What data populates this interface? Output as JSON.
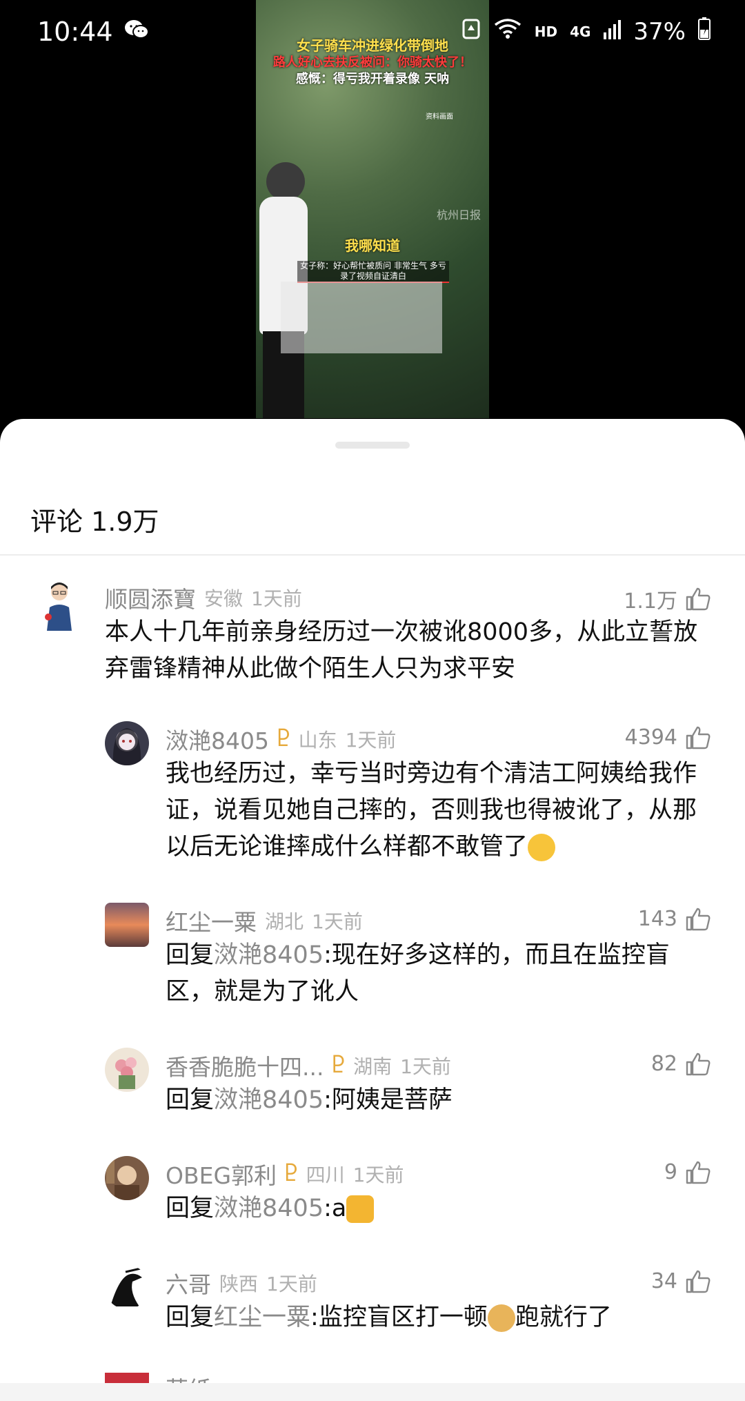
{
  "status": {
    "time": "10:44",
    "right": {
      "hd": "HD",
      "network": "4G",
      "battery": "37%"
    }
  },
  "video": {
    "caption_line1": "女子骑车冲进绿化带倒地",
    "caption_line2": "路人好心去扶反被问：你骑太快了！",
    "caption_line3": "感慨：得亏我开着录像 天呐",
    "credit": "资料画面",
    "watermark": "杭州日报",
    "speech": "我哪知道",
    "claim": "女子称：好心帮忙被质问 非常生气 多亏录了视频自证清白"
  },
  "sheet": {
    "title": "评论 1.9万",
    "comments": [
      {
        "name": "顺圆添寶",
        "region": "安徽",
        "time": "1天前",
        "likes": "1.1万",
        "text": "本人十几年前亲身经历过一次被讹8000多，从此立誓放弃雷锋精神从此做个陌生人只为求平安"
      },
      {
        "name": "滧滟8405",
        "region": "山东",
        "time": "1天前",
        "likes": "4394",
        "text": "我也经历过，幸亏当时旁边有个清洁工阿姨给我作证，说看见她自己摔的，否则我也得被讹了，从那以后无论谁摔成什么样都不敢管了"
      },
      {
        "name": "红尘一粟",
        "region": "湖北",
        "time": "1天前",
        "likes": "143",
        "reply_prefix": "回复",
        "reply_target": "滧滟8405",
        "text": ":现在好多这样的，而且在监控盲区，就是为了讹人"
      },
      {
        "name": "香香脆脆十四...",
        "region": "湖南",
        "time": "1天前",
        "likes": "82",
        "reply_prefix": "回复",
        "reply_target": "滧滟8405",
        "text": ":阿姨是菩萨"
      },
      {
        "name": "OBEG郭利",
        "region": "四川",
        "time": "1天前",
        "likes": "9",
        "reply_prefix": "回复",
        "reply_target": "滧滟8405",
        "text": ":a"
      },
      {
        "name": "六哥",
        "region": "陕西",
        "time": "1天前",
        "likes": "34",
        "reply_prefix": "回复",
        "reply_target": "红尘一粟",
        "text": ":监控盲区打一顿",
        "text_after": "跑就行了"
      }
    ],
    "partial_name": "草纸..."
  },
  "colors": {
    "crown": "#e6a93b",
    "secondary": "#8a8a8a",
    "region": "#b0b0b0"
  }
}
